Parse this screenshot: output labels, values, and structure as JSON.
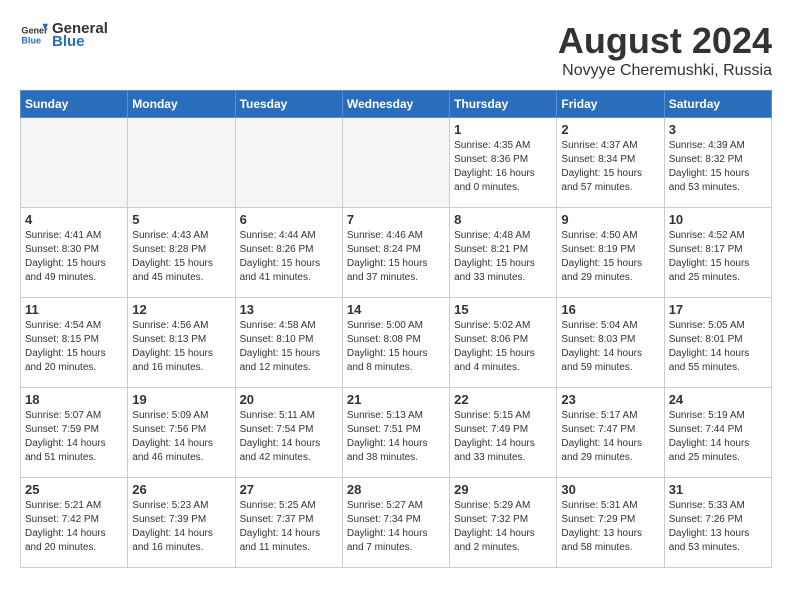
{
  "header": {
    "logo_general": "General",
    "logo_blue": "Blue",
    "month_year": "August 2024",
    "location": "Novyye Cheremushki, Russia"
  },
  "days_of_week": [
    "Sunday",
    "Monday",
    "Tuesday",
    "Wednesday",
    "Thursday",
    "Friday",
    "Saturday"
  ],
  "weeks": [
    [
      {
        "num": "",
        "detail": "",
        "empty": true
      },
      {
        "num": "",
        "detail": "",
        "empty": true
      },
      {
        "num": "",
        "detail": "",
        "empty": true
      },
      {
        "num": "",
        "detail": "",
        "empty": true
      },
      {
        "num": "1",
        "detail": "Sunrise: 4:35 AM\nSunset: 8:36 PM\nDaylight: 16 hours\nand 0 minutes."
      },
      {
        "num": "2",
        "detail": "Sunrise: 4:37 AM\nSunset: 8:34 PM\nDaylight: 15 hours\nand 57 minutes."
      },
      {
        "num": "3",
        "detail": "Sunrise: 4:39 AM\nSunset: 8:32 PM\nDaylight: 15 hours\nand 53 minutes."
      }
    ],
    [
      {
        "num": "4",
        "detail": "Sunrise: 4:41 AM\nSunset: 8:30 PM\nDaylight: 15 hours\nand 49 minutes."
      },
      {
        "num": "5",
        "detail": "Sunrise: 4:43 AM\nSunset: 8:28 PM\nDaylight: 15 hours\nand 45 minutes."
      },
      {
        "num": "6",
        "detail": "Sunrise: 4:44 AM\nSunset: 8:26 PM\nDaylight: 15 hours\nand 41 minutes."
      },
      {
        "num": "7",
        "detail": "Sunrise: 4:46 AM\nSunset: 8:24 PM\nDaylight: 15 hours\nand 37 minutes."
      },
      {
        "num": "8",
        "detail": "Sunrise: 4:48 AM\nSunset: 8:21 PM\nDaylight: 15 hours\nand 33 minutes."
      },
      {
        "num": "9",
        "detail": "Sunrise: 4:50 AM\nSunset: 8:19 PM\nDaylight: 15 hours\nand 29 minutes."
      },
      {
        "num": "10",
        "detail": "Sunrise: 4:52 AM\nSunset: 8:17 PM\nDaylight: 15 hours\nand 25 minutes."
      }
    ],
    [
      {
        "num": "11",
        "detail": "Sunrise: 4:54 AM\nSunset: 8:15 PM\nDaylight: 15 hours\nand 20 minutes."
      },
      {
        "num": "12",
        "detail": "Sunrise: 4:56 AM\nSunset: 8:13 PM\nDaylight: 15 hours\nand 16 minutes."
      },
      {
        "num": "13",
        "detail": "Sunrise: 4:58 AM\nSunset: 8:10 PM\nDaylight: 15 hours\nand 12 minutes."
      },
      {
        "num": "14",
        "detail": "Sunrise: 5:00 AM\nSunset: 8:08 PM\nDaylight: 15 hours\nand 8 minutes."
      },
      {
        "num": "15",
        "detail": "Sunrise: 5:02 AM\nSunset: 8:06 PM\nDaylight: 15 hours\nand 4 minutes."
      },
      {
        "num": "16",
        "detail": "Sunrise: 5:04 AM\nSunset: 8:03 PM\nDaylight: 14 hours\nand 59 minutes."
      },
      {
        "num": "17",
        "detail": "Sunrise: 5:05 AM\nSunset: 8:01 PM\nDaylight: 14 hours\nand 55 minutes."
      }
    ],
    [
      {
        "num": "18",
        "detail": "Sunrise: 5:07 AM\nSunset: 7:59 PM\nDaylight: 14 hours\nand 51 minutes."
      },
      {
        "num": "19",
        "detail": "Sunrise: 5:09 AM\nSunset: 7:56 PM\nDaylight: 14 hours\nand 46 minutes."
      },
      {
        "num": "20",
        "detail": "Sunrise: 5:11 AM\nSunset: 7:54 PM\nDaylight: 14 hours\nand 42 minutes."
      },
      {
        "num": "21",
        "detail": "Sunrise: 5:13 AM\nSunset: 7:51 PM\nDaylight: 14 hours\nand 38 minutes."
      },
      {
        "num": "22",
        "detail": "Sunrise: 5:15 AM\nSunset: 7:49 PM\nDaylight: 14 hours\nand 33 minutes."
      },
      {
        "num": "23",
        "detail": "Sunrise: 5:17 AM\nSunset: 7:47 PM\nDaylight: 14 hours\nand 29 minutes."
      },
      {
        "num": "24",
        "detail": "Sunrise: 5:19 AM\nSunset: 7:44 PM\nDaylight: 14 hours\nand 25 minutes."
      }
    ],
    [
      {
        "num": "25",
        "detail": "Sunrise: 5:21 AM\nSunset: 7:42 PM\nDaylight: 14 hours\nand 20 minutes."
      },
      {
        "num": "26",
        "detail": "Sunrise: 5:23 AM\nSunset: 7:39 PM\nDaylight: 14 hours\nand 16 minutes."
      },
      {
        "num": "27",
        "detail": "Sunrise: 5:25 AM\nSunset: 7:37 PM\nDaylight: 14 hours\nand 11 minutes."
      },
      {
        "num": "28",
        "detail": "Sunrise: 5:27 AM\nSunset: 7:34 PM\nDaylight: 14 hours\nand 7 minutes."
      },
      {
        "num": "29",
        "detail": "Sunrise: 5:29 AM\nSunset: 7:32 PM\nDaylight: 14 hours\nand 2 minutes."
      },
      {
        "num": "30",
        "detail": "Sunrise: 5:31 AM\nSunset: 7:29 PM\nDaylight: 13 hours\nand 58 minutes."
      },
      {
        "num": "31",
        "detail": "Sunrise: 5:33 AM\nSunset: 7:26 PM\nDaylight: 13 hours\nand 53 minutes."
      }
    ]
  ]
}
